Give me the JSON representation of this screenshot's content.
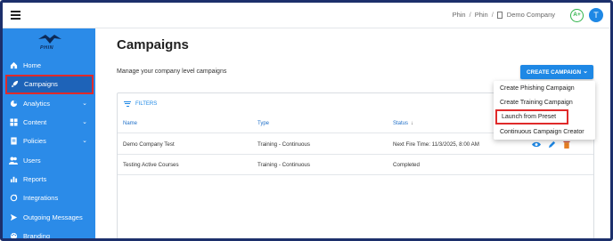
{
  "topbar": {
    "breadcrumbs": [
      "Phin",
      "Phin",
      "Demo Company"
    ],
    "separator": "/",
    "avatar_a": "A+",
    "avatar_t": "T"
  },
  "sidebar": {
    "logo_text": "PHIN",
    "items": [
      {
        "label": "Home",
        "icon": "home-icon"
      },
      {
        "label": "Campaigns",
        "icon": "rocket-icon",
        "active": true
      },
      {
        "label": "Analytics",
        "icon": "chart-icon",
        "expandable": true
      },
      {
        "label": "Content",
        "icon": "grid-icon",
        "expandable": true
      },
      {
        "label": "Policies",
        "icon": "policy-icon",
        "expandable": true
      },
      {
        "label": "Users",
        "icon": "users-icon"
      },
      {
        "label": "Reports",
        "icon": "bar-chart-icon"
      },
      {
        "label": "Integrations",
        "icon": "sync-icon"
      },
      {
        "label": "Outgoing Messages",
        "icon": "send-icon"
      },
      {
        "label": "Branding",
        "icon": "palette-icon"
      }
    ]
  },
  "main": {
    "title": "Campaigns",
    "subtitle": "Manage your company level campaigns",
    "create_button": "CREATE CAMPAIGN",
    "filters": "FILTERS",
    "columns": [
      "Name",
      "Type",
      "Status"
    ],
    "rows": [
      {
        "name": "Demo Company Test",
        "type": "Training - Continuous",
        "status": "Next Fire Time: 11/3/2025, 8:00 AM"
      },
      {
        "name": "Testing Active Courses",
        "type": "Training - Continuous",
        "status": "Completed"
      }
    ]
  },
  "menu": {
    "items": [
      "Create Phishing Campaign",
      "Create Training Campaign",
      "Launch from Preset",
      "Continuous Campaign Creator"
    ]
  },
  "colors": {
    "sidebar": "#2b8be8",
    "accent": "#1e88e5",
    "highlight": "#e02a2a",
    "avatar_a": "#2fb34a"
  }
}
